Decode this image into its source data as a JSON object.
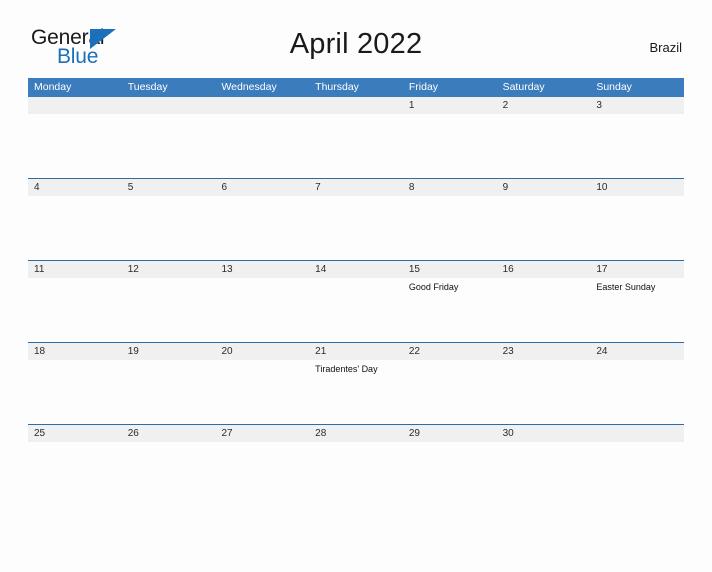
{
  "logo": {
    "word_top": "General",
    "word_bottom": "Blue",
    "accent_color": "#1c6fba"
  },
  "header": {
    "title": "April 2022",
    "country": "Brazil"
  },
  "theme": {
    "header_blue": "#3b7cbd",
    "row_border_blue": "#2e6da4",
    "date_band_grey": "#f0f0f0",
    "page_background": "#fdfdfd"
  },
  "calendar": {
    "weekdays": [
      "Monday",
      "Tuesday",
      "Wednesday",
      "Thursday",
      "Friday",
      "Saturday",
      "Sunday"
    ],
    "weeks": [
      [
        {
          "date": "",
          "event": ""
        },
        {
          "date": "",
          "event": ""
        },
        {
          "date": "",
          "event": ""
        },
        {
          "date": "",
          "event": ""
        },
        {
          "date": "1",
          "event": ""
        },
        {
          "date": "2",
          "event": ""
        },
        {
          "date": "3",
          "event": ""
        }
      ],
      [
        {
          "date": "4",
          "event": ""
        },
        {
          "date": "5",
          "event": ""
        },
        {
          "date": "6",
          "event": ""
        },
        {
          "date": "7",
          "event": ""
        },
        {
          "date": "8",
          "event": ""
        },
        {
          "date": "9",
          "event": ""
        },
        {
          "date": "10",
          "event": ""
        }
      ],
      [
        {
          "date": "11",
          "event": ""
        },
        {
          "date": "12",
          "event": ""
        },
        {
          "date": "13",
          "event": ""
        },
        {
          "date": "14",
          "event": ""
        },
        {
          "date": "15",
          "event": "Good Friday"
        },
        {
          "date": "16",
          "event": ""
        },
        {
          "date": "17",
          "event": "Easter Sunday"
        }
      ],
      [
        {
          "date": "18",
          "event": ""
        },
        {
          "date": "19",
          "event": ""
        },
        {
          "date": "20",
          "event": ""
        },
        {
          "date": "21",
          "event": "Tiradentes' Day"
        },
        {
          "date": "22",
          "event": ""
        },
        {
          "date": "23",
          "event": ""
        },
        {
          "date": "24",
          "event": ""
        }
      ],
      [
        {
          "date": "25",
          "event": ""
        },
        {
          "date": "26",
          "event": ""
        },
        {
          "date": "27",
          "event": ""
        },
        {
          "date": "28",
          "event": ""
        },
        {
          "date": "29",
          "event": ""
        },
        {
          "date": "30",
          "event": ""
        },
        {
          "date": "",
          "event": ""
        }
      ]
    ]
  }
}
